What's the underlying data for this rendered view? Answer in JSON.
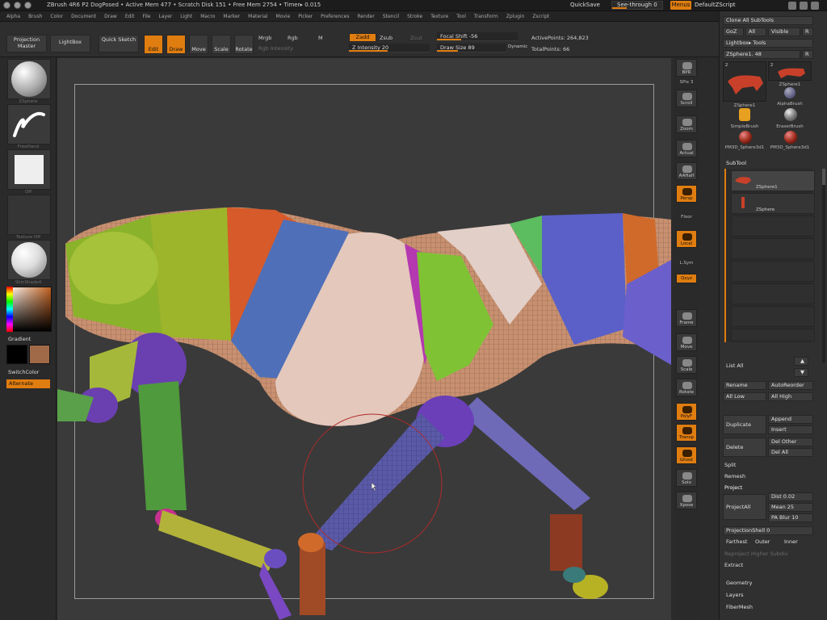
{
  "titlebar": {
    "title": "ZBrush 4R6 P2      DogPosed     • Active Mem 477  • Scratch Disk 151  • Free Mem 2754  • Timer▸ 0.015",
    "quicksave": "QuickSave",
    "see_through": "See-through  0",
    "menus": "Menus",
    "default_script": "DefaultZScript"
  },
  "menubar": [
    "Alpha",
    "Brush",
    "Color",
    "Document",
    "Draw",
    "Edit",
    "File",
    "Layer",
    "Light",
    "Macro",
    "Marker",
    "Material",
    "Movie",
    "Picker",
    "Preferences",
    "Render",
    "Stencil",
    "Stroke",
    "Texture",
    "Tool",
    "Transform",
    "Zplugin",
    "Zscript"
  ],
  "toolbar": {
    "projection_master": "Projection Master",
    "lightbox": "LightBox",
    "quick_sketch": "Quick Sketch",
    "edit": "Edit",
    "draw": "Draw",
    "move": "Move",
    "scale": "Scale",
    "rotate": "Rotate",
    "mrgb": "Mrgb",
    "rgb": "Rgb",
    "m": "M",
    "rgb_intensity": "Rgb Intensity",
    "zadd": "Zadd",
    "zsub": "Zsub",
    "zcut": "Zcut",
    "z_intensity": "Z Intensity 20",
    "focal_shift": "Focal Shift -56",
    "draw_size": "Draw Size 89",
    "dynamic": "Dynamic",
    "active_points": "ActivePoints: 264,823",
    "total_points": "TotalPoints: 66"
  },
  "left_shelf": {
    "brush_label": "ZSphere",
    "stroke_label": "FreeHand",
    "alpha_label": "Off",
    "texture_label": "Texture Off",
    "material_label": "SkinShade4",
    "gradient": "Gradient",
    "switch_color": "SwitchColor",
    "alternate": "Alternate",
    "main_color": "#000000",
    "secondary_color": "#a06a48"
  },
  "right_shelf": [
    "BPR",
    "SPix 3",
    "Scroll",
    "Zoom",
    "Actual",
    "AAHalf",
    "Persp",
    "Floor",
    "Local",
    "L.Sym",
    "Qxyz",
    "Frame",
    "Move",
    "Scale",
    "Rotate",
    "PolyF",
    "Transp",
    "Ghost",
    "Solo",
    "Xpose"
  ],
  "panel": {
    "clone_all_subtools": "Clone All SubTools",
    "goz": "GoZ",
    "all": "All",
    "visible": "Visible",
    "r": "R",
    "lightbox_tools": "Lightbox▸ Tools",
    "zsphere_slider": "ZSphere1. 48",
    "tools": [
      {
        "name": "ZSphere1",
        "count": "2"
      },
      {
        "name": "ZSphere1",
        "count": "2"
      },
      {
        "name": "AlphaBrush"
      },
      {
        "name": "SimpleBrush"
      },
      {
        "name": "EraserBrush"
      },
      {
        "name": "PM3D_Sphere3d1"
      },
      {
        "name": "PM3D_Sphere3d1"
      }
    ],
    "subtool_header": "SubTool",
    "subtools": [
      "ZSphere1",
      "ZSphere"
    ],
    "list_all": "List All",
    "rename": "Rename",
    "auto_reorder": "AutoReorder",
    "all_low": "All Low",
    "all_high": "All High",
    "duplicate": "Duplicate",
    "append": "Append",
    "insert": "Insert",
    "delete": "Delete",
    "del_other": "Del Other",
    "del_all": "Del All",
    "split": "Split",
    "remesh": "Remesh",
    "project": "Project",
    "project_all": "ProjectAll",
    "dist": "Dist 0.02",
    "mean": "Mean 25",
    "pa_blur": "PA Blur 10",
    "projection_shell": "ProjectionShell 0",
    "farthest": "Farthest",
    "outer": "Outer",
    "inner": "Inner",
    "reproject_higher_subdiv": "Reproject Higher Subdiv",
    "extract": "Extract",
    "geometry": "Geometry",
    "layers": "Layers",
    "fibermesh": "FiberMesh"
  },
  "colors": {
    "accent": "#e07d10",
    "canvas_bg": "#3a3a3a",
    "ui_bg": "#2e2e2e"
  }
}
